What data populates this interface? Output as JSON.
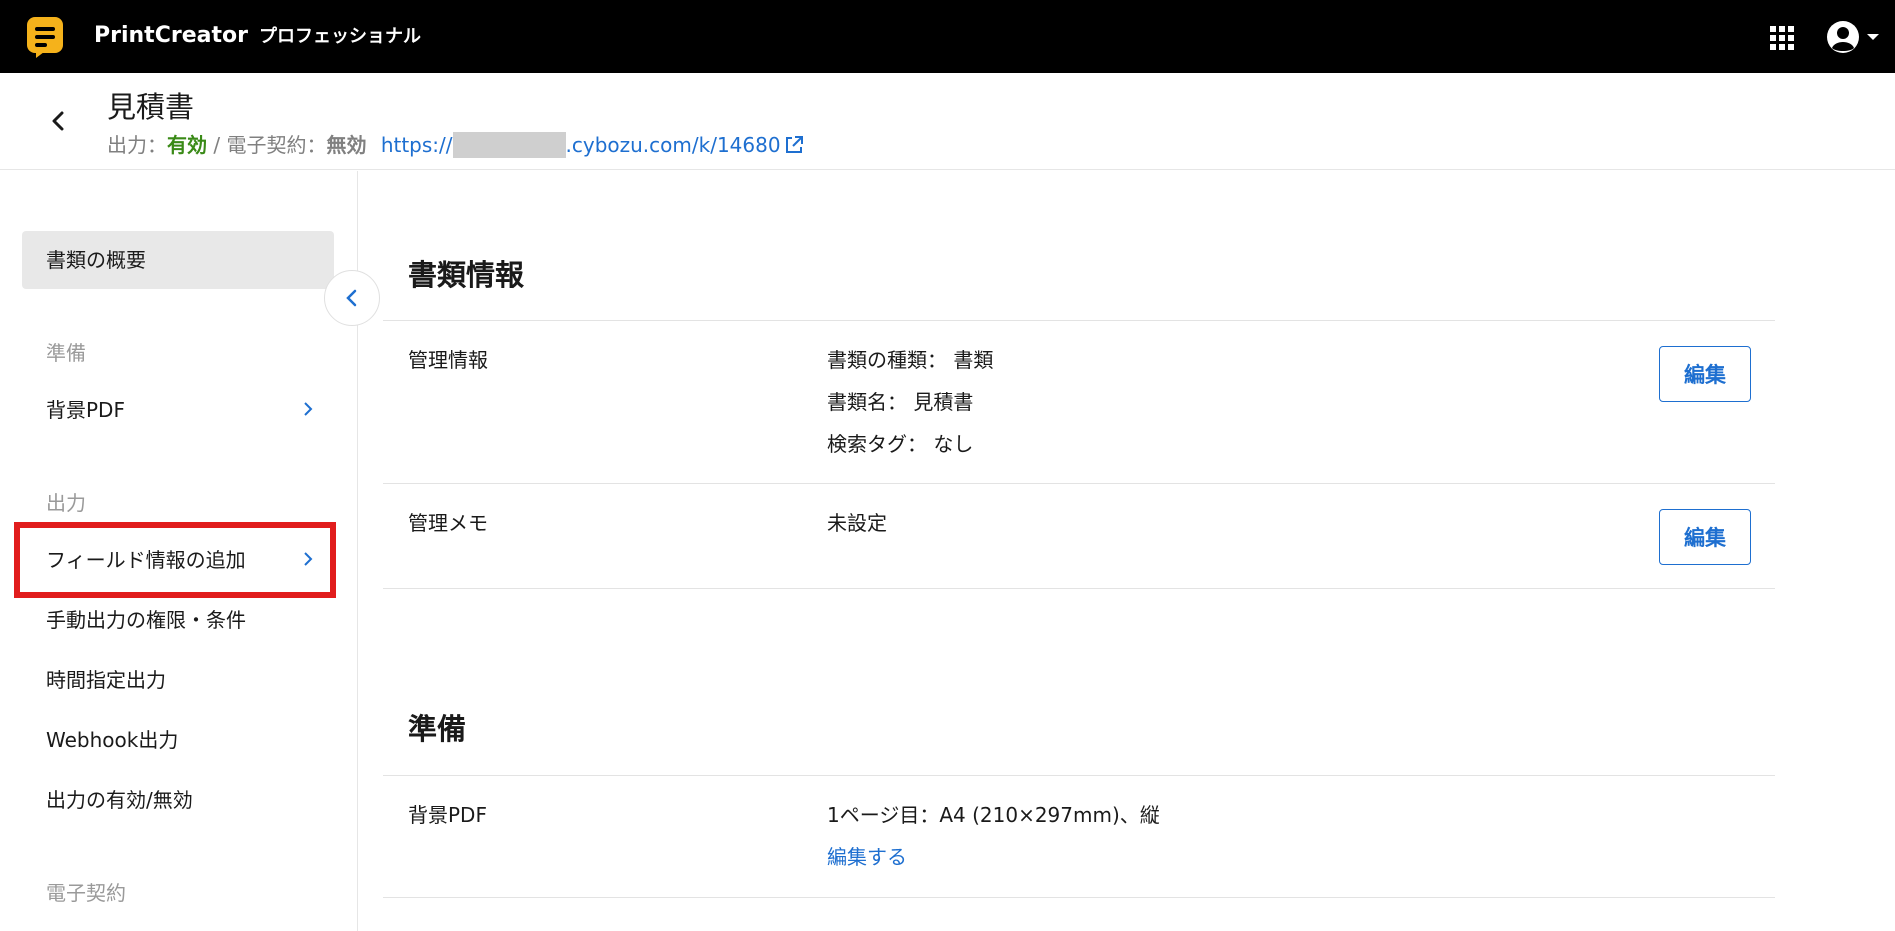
{
  "topbar": {
    "app_name": "PrintCreator",
    "plan": "プロフェッショナル",
    "icons": [
      "app-logo-icon",
      "apps-grid-icon",
      "account-icon",
      "caret-down-icon"
    ]
  },
  "header": {
    "title": "見積書",
    "output_label": "出力：",
    "output_value": "有効",
    "separator": " / ",
    "esign_label": "電子契約：",
    "esign_value": "無効",
    "url_prefix": "https://",
    "url_suffix": ".cybozu.com/k/14680"
  },
  "sidebar": {
    "overview": "書類の概要",
    "sections": {
      "prepare": "準備",
      "output": "出力",
      "esign": "電子契約"
    },
    "items": {
      "background_pdf": "背景PDF",
      "add_field_info": "フィールド情報の追加",
      "manual_output": "手動出力の権限・条件",
      "scheduled_output": "時間指定出力",
      "webhook_output": "Webhook出力",
      "output_toggle": "出力の有効/無効"
    }
  },
  "main": {
    "doc_info": {
      "title": "書類情報",
      "management_info": {
        "label": "管理情報",
        "type": "書類の種類： 書類",
        "name": "書類名： 見積書",
        "tags": "検索タグ： なし",
        "edit": "編集"
      },
      "management_memo": {
        "label": "管理メモ",
        "value": "未設定",
        "edit": "編集"
      }
    },
    "prepare": {
      "title": "準備",
      "background_pdf": {
        "label": "背景PDF",
        "value": "1ページ目：A4 (210×297mm)、縦",
        "edit_link": "編集する"
      }
    }
  },
  "colors": {
    "accent": "#1e6fd0",
    "enabled": "#3a8a17",
    "highlight": "#e11d1d",
    "logo": "#f5b21b"
  }
}
